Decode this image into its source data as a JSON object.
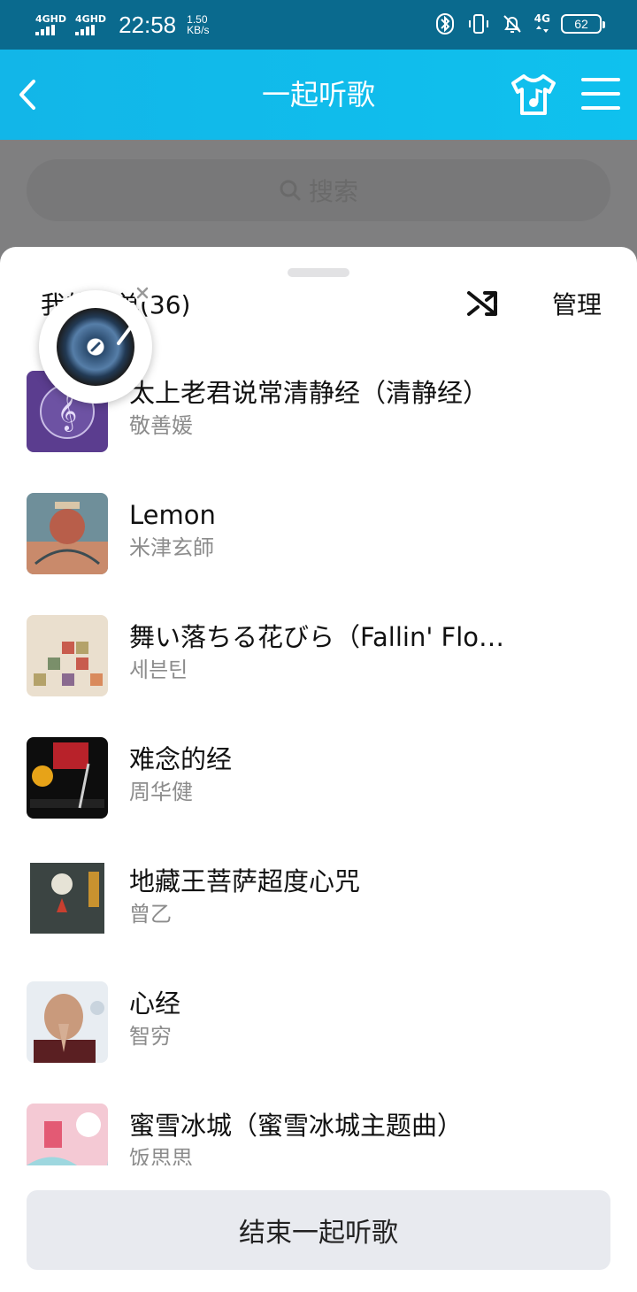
{
  "status_bar": {
    "signal1_label": "4GHD",
    "signal2_label": "4GHD",
    "time": "22:58",
    "speed_value": "1.50",
    "speed_unit": "KB/s",
    "network_label": "4G",
    "battery": "62"
  },
  "header": {
    "title": "一起听歌"
  },
  "search": {
    "placeholder": "搜索"
  },
  "sheet": {
    "list_title": "我的歌单(36)",
    "manage_label": "管理",
    "end_button_label": "结束一起听歌"
  },
  "songs": [
    {
      "name": "太上老君说常清静经（清静经）",
      "artist": "敬善媛"
    },
    {
      "name": "Lemon",
      "artist": "米津玄師"
    },
    {
      "name": "舞い落ちる花びら（Fallin' Flo…",
      "artist": "세븐틴"
    },
    {
      "name": "难念的经",
      "artist": "周华健"
    },
    {
      "name": "地藏王菩萨超度心咒",
      "artist": "曾乙"
    },
    {
      "name": "心经",
      "artist": "智穷"
    },
    {
      "name": "蜜雪冰城（蜜雪冰城主题曲）",
      "artist": "饭思思"
    }
  ],
  "colors": {
    "header_bg": "#12b6e8",
    "status_bar_bg": "#0a6a8e",
    "end_button_bg": "#e8eaef"
  }
}
